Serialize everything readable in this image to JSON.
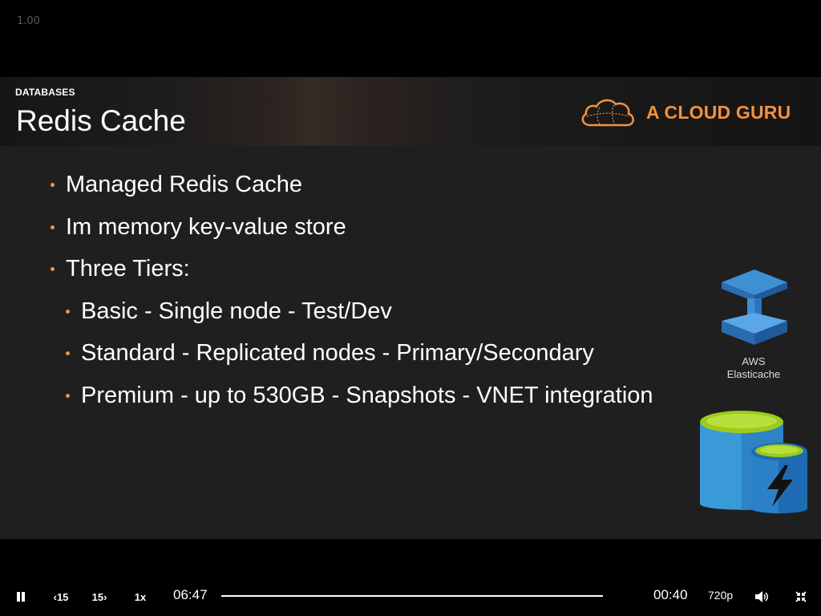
{
  "overlay": {
    "playback_rate": "1.00"
  },
  "slide": {
    "section": "DATABASES",
    "title": "Redis Cache",
    "brand": "A CLOUD GURU",
    "bullets": [
      "Managed Redis Cache",
      "Im memory key-value store",
      "Three Tiers:"
    ],
    "sub_bullets": [
      "Basic - Single node - Test/Dev",
      "Standard - Replicated nodes - Primary/Secondary",
      "Premium - up to 530GB - Snapshots - VNET integration"
    ],
    "aws_logo_label_line1": "AWS",
    "aws_logo_label_line2": "Elasticache"
  },
  "player": {
    "pause_icon": "pause-icon",
    "rewind_label": "15",
    "forward_label": "15",
    "speed_label": "1x",
    "time_remaining": "06:47",
    "time_elapsed": "00:40",
    "quality": "720p",
    "volume_icon": "volume-icon",
    "exit_fullscreen_icon": "exit-fullscreen-icon",
    "progress_fraction": 0.0
  },
  "colors": {
    "accent_orange": "#f5913e",
    "slide_background": "#1f1f1f"
  }
}
